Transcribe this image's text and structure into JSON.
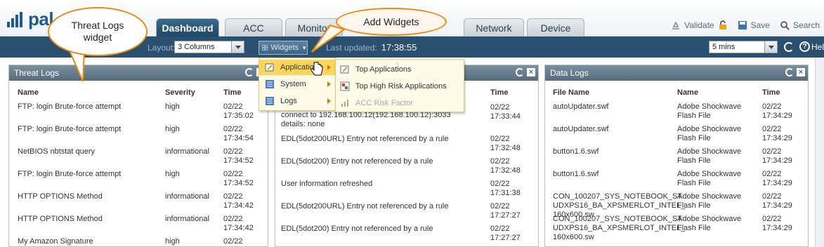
{
  "app": {
    "brand": "pal",
    "colors": {
      "accent": "#1f5a8a",
      "toolbar": "#2b4f6f",
      "highlight": "#ffd65a",
      "callout_border": "#e98a12"
    }
  },
  "tabs": [
    {
      "label": "Dashboard",
      "active": true
    },
    {
      "label": "ACC"
    },
    {
      "label": "Monitor"
    },
    {
      "label": "Network"
    },
    {
      "label": "Device"
    }
  ],
  "top_actions": {
    "validate": "Validate",
    "save": "Save",
    "search": "Search"
  },
  "toolbar": {
    "layout_label": "Layout:",
    "layout_value": "3 Columns",
    "widgets_label": "Widgets",
    "last_updated_label": "Last updated:",
    "last_updated_value": "17:38:55",
    "refresh_value": "5 mins",
    "help_label": "Hel"
  },
  "menu": {
    "items": [
      {
        "label": "Application",
        "icon": "edit-icon"
      },
      {
        "label": "System",
        "icon": "list-icon"
      },
      {
        "label": "Logs",
        "icon": "list-icon"
      }
    ],
    "submenu": [
      {
        "label": "Top Applications",
        "icon": "edit-icon"
      },
      {
        "label": "Top High Risk Applications",
        "icon": "chart-icon"
      },
      {
        "label": "ACC Risk Factor",
        "icon": "bars-icon",
        "disabled": true
      }
    ]
  },
  "callouts": {
    "threat_logs": "Threat Logs widget",
    "add_widgets": "Add Widgets"
  },
  "threat_logs": {
    "title": "Threat Logs",
    "columns": [
      "Name",
      "Severity",
      "Time"
    ],
    "rows": [
      {
        "name": "FTP: login Brute-force attempt",
        "severity": "high",
        "date": "02/22",
        "time": "17:35:02"
      },
      {
        "name": "FTP: login Brute-force attempt",
        "severity": "high",
        "date": "02/22",
        "time": "17:34:54"
      },
      {
        "name": "NetBIOS nbtstat query",
        "severity": "informational",
        "date": "02/22",
        "time": "17:34:52"
      },
      {
        "name": "FTP: login Brute-force attempt",
        "severity": "high",
        "date": "02/22",
        "time": "17:34:52"
      },
      {
        "name": "HTTP OPTIONS Method",
        "severity": "informational",
        "date": "02/22",
        "time": "17:34:42"
      },
      {
        "name": "HTTP OPTIONS Method",
        "severity": "informational",
        "date": "02/22",
        "time": "17:34:42"
      },
      {
        "name": "My Amazon Signature",
        "severity": "high",
        "date": "02/22",
        "time": ""
      }
    ]
  },
  "system_logs": {
    "columns": [
      "Time"
    ],
    "rows": [
      {
        "desc_lines": [
          "connect to 192.168.100.12(192.168.100.12):3033",
          "details: none"
        ],
        "date": "02/22",
        "time": "17:33:44"
      },
      {
        "desc_lines": [
          "EDL(5dot200URL) Entry not referenced by a rule"
        ],
        "date": "02/22",
        "time": "17:32:48"
      },
      {
        "desc_lines": [
          "EDL(5dot200) Entry not referenced by a rule"
        ],
        "date": "02/22",
        "time": "17:32:48"
      },
      {
        "desc_lines": [
          "User information refreshed"
        ],
        "date": "02/22",
        "time": "17:31:38"
      },
      {
        "desc_lines": [
          "EDL(5dot200URL) Entry not referenced by a rule"
        ],
        "date": "02/22",
        "time": "17:27:27"
      },
      {
        "desc_lines": [
          "EDL(5dot200) Entry not referenced by a rule"
        ],
        "date": "02/22",
        "time": "17:27:27"
      }
    ]
  },
  "data_logs": {
    "title": "Data Logs",
    "columns": [
      "File Name",
      "Name",
      "Time"
    ],
    "rows": [
      {
        "file": [
          "autoUpdater.swf"
        ],
        "name": [
          "Adobe Shockwave",
          "Flash File"
        ],
        "date": "02/22",
        "time": "17:34:29"
      },
      {
        "file": [
          "autoUpdater.swf"
        ],
        "name": [
          "Adobe Shockwave",
          "Flash File"
        ],
        "date": "02/22",
        "time": "17:34:29"
      },
      {
        "file": [
          "button1.6.swf"
        ],
        "name": [
          "Adobe Shockwave",
          "Flash File"
        ],
        "date": "02/22",
        "time": "17:34:29"
      },
      {
        "file": [
          "button1.6.swf"
        ],
        "name": [
          "Adobe Shockwave",
          "Flash File"
        ],
        "date": "02/22",
        "time": "17:34:29"
      },
      {
        "file": [
          "CON_100207_SYS_NOTEBOOK_ST",
          "UDXPS16_BA_XPSMERLOT_INTEL_",
          "160x600.sw"
        ],
        "name": [
          "Adobe Shockwave",
          "Flash File"
        ],
        "date": "02/22",
        "time": "17:34:29"
      },
      {
        "file": [
          "CON_100207_SYS_NOTEBOOK_ST",
          "UDXPS16_BA_XPSMERLOT_INTEL_",
          "160x600.sw"
        ],
        "name": [
          "Adobe Shockwave",
          "Flash File"
        ],
        "date": "02/22",
        "time": "17:34:29"
      }
    ]
  }
}
